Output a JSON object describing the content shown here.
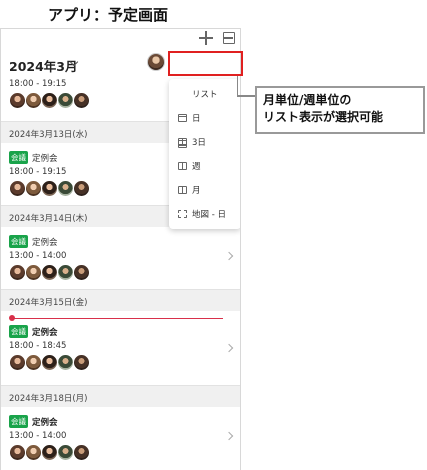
{
  "caption": "アプリ：予定画面",
  "header": {
    "month": "2024年3月"
  },
  "top_event": {
    "time": "18:00 - 19:15"
  },
  "days": [
    {
      "date": "2024年3月13日(水)",
      "badge": "会議",
      "title": "定例会",
      "time": "18:00 - 19:15"
    },
    {
      "date": "2024年3月14日(木)",
      "badge": "会議",
      "title": "定例会",
      "time": "13:00 - 14:00"
    },
    {
      "date": "2024年3月15日(金)",
      "badge": "会議",
      "title": "定例会",
      "time": "18:00 - 18:45"
    },
    {
      "date": "2024年3月18日(月)",
      "badge": "会議",
      "title": "定例会",
      "time": "13:00 - 14:00"
    }
  ],
  "view_menu": {
    "items": [
      {
        "label": "リスト",
        "icon": "list-view-icon"
      },
      {
        "label": "日",
        "icon": "day-view-icon"
      },
      {
        "label": "3日",
        "icon": "three-day-view-icon"
      },
      {
        "label": "週",
        "icon": "week-view-icon"
      },
      {
        "label": "月",
        "icon": "month-view-icon"
      },
      {
        "label": "地図 - 日",
        "icon": "map-view-icon"
      }
    ]
  },
  "callout": {
    "line1": "月単位/週単位の",
    "line2": "リスト表示が選択可能"
  },
  "colors": {
    "badge": "#19a34a",
    "now_line": "#d8304a",
    "highlight": "#e02020"
  }
}
